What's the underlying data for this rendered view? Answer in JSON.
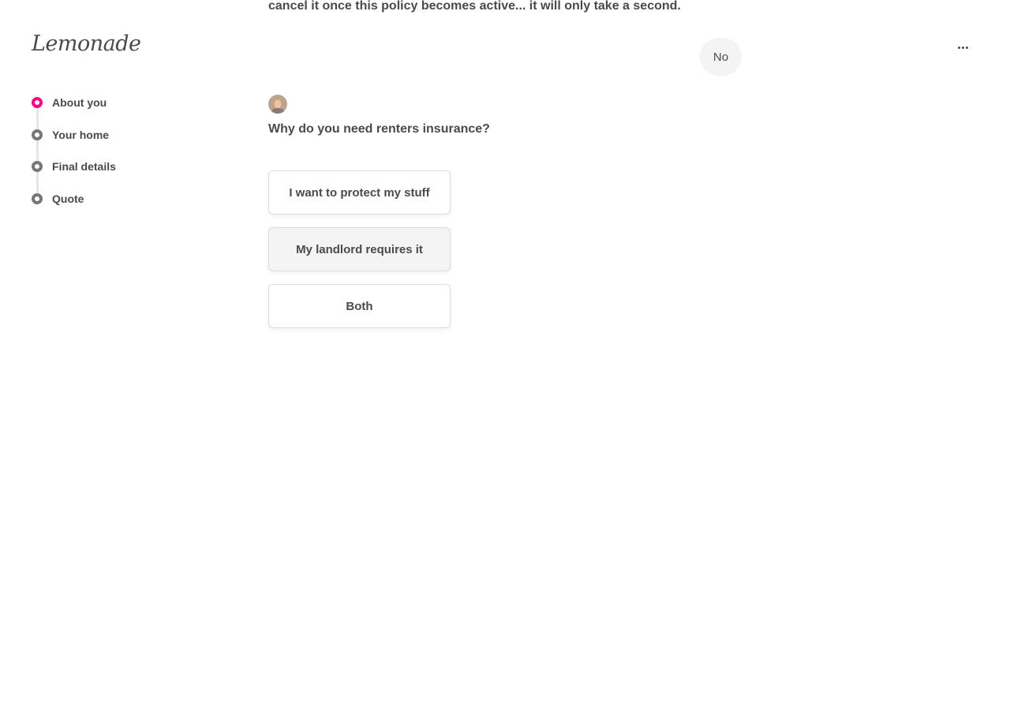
{
  "brand": {
    "logo_text": "Lemonade"
  },
  "header": {
    "more_icon": "ellipsis-icon"
  },
  "sidebar": {
    "steps": [
      {
        "label": "About you",
        "state": "active"
      },
      {
        "label": "Your home",
        "state": "upcoming"
      },
      {
        "label": "Final details",
        "state": "upcoming"
      },
      {
        "label": "Quote",
        "state": "upcoming"
      }
    ],
    "active_color": "#ff0083"
  },
  "chat": {
    "previous_bot_message": "cancel it once this policy becomes active... it will only take a second.",
    "user_reply": "No",
    "question": "Why do you need renters insurance?",
    "options": [
      {
        "label": "I want to protect my stuff"
      },
      {
        "label": "My landlord requires it"
      },
      {
        "label": "Both"
      }
    ]
  }
}
